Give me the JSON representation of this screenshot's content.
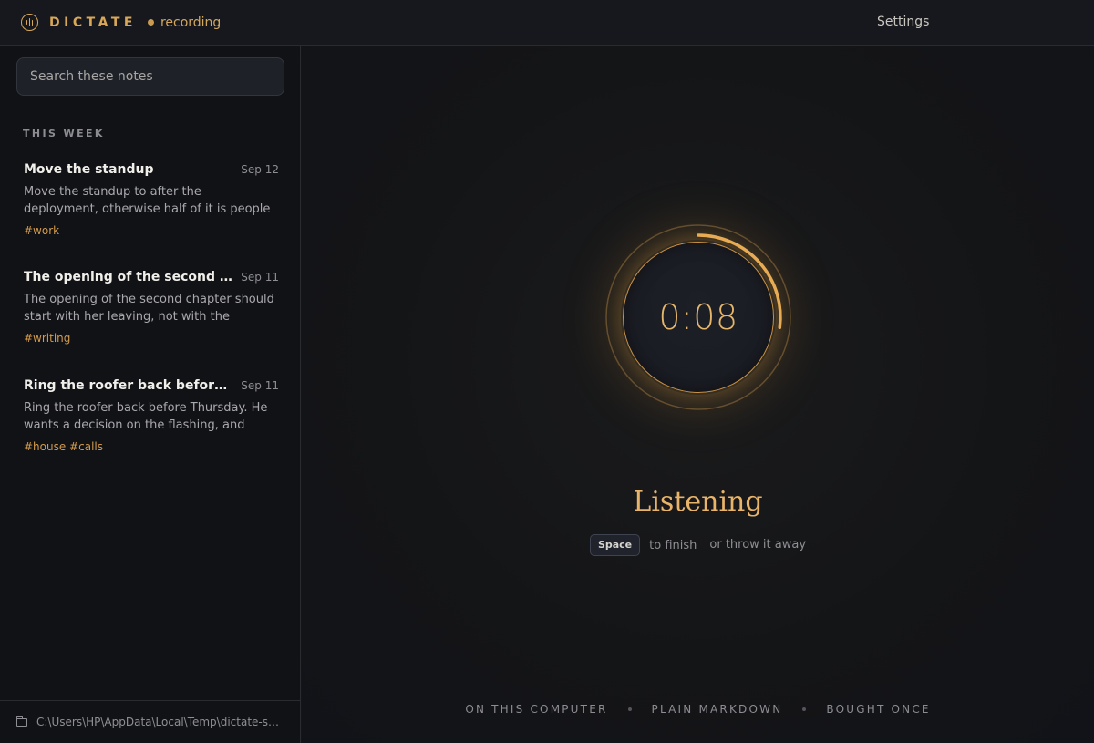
{
  "app": {
    "brand_name": "DICTATE",
    "recording_label": "recording",
    "settings_label": "Settings",
    "accent_color": "#d9a857"
  },
  "sidebar": {
    "search_placeholder": "Search these notes",
    "section_label": "THIS WEEK",
    "notes": [
      {
        "title": "Move the standup",
        "date": "Sep 12",
        "preview": "Move the standup to after the deployment, otherwise half of it is people guessing...",
        "tags": "#work"
      },
      {
        "title": "The opening of the second chap...",
        "date": "Sep 11",
        "preview": "The opening of the second chapter should start with her leaving, not with the argument...",
        "tags": "#writing"
      },
      {
        "title": "Ring the roofer back before Thur...",
        "date": "Sep 11",
        "preview": "Ring the roofer back before Thursday. He wants a decision on the flashing, and the...",
        "tags": "#house #calls"
      }
    ],
    "storage_path": "C:\\Users\\HP\\AppData\\Local\\Temp\\dictate-shot..."
  },
  "recorder": {
    "elapsed": "0:08",
    "progress_fraction": 0.27,
    "status": "Listening",
    "key_label": "Space",
    "finish_hint": "to finish",
    "discard_label": "or throw it away"
  },
  "footer": {
    "items": [
      "ON THIS COMPUTER",
      "PLAIN MARKDOWN",
      "BOUGHT ONCE"
    ]
  }
}
